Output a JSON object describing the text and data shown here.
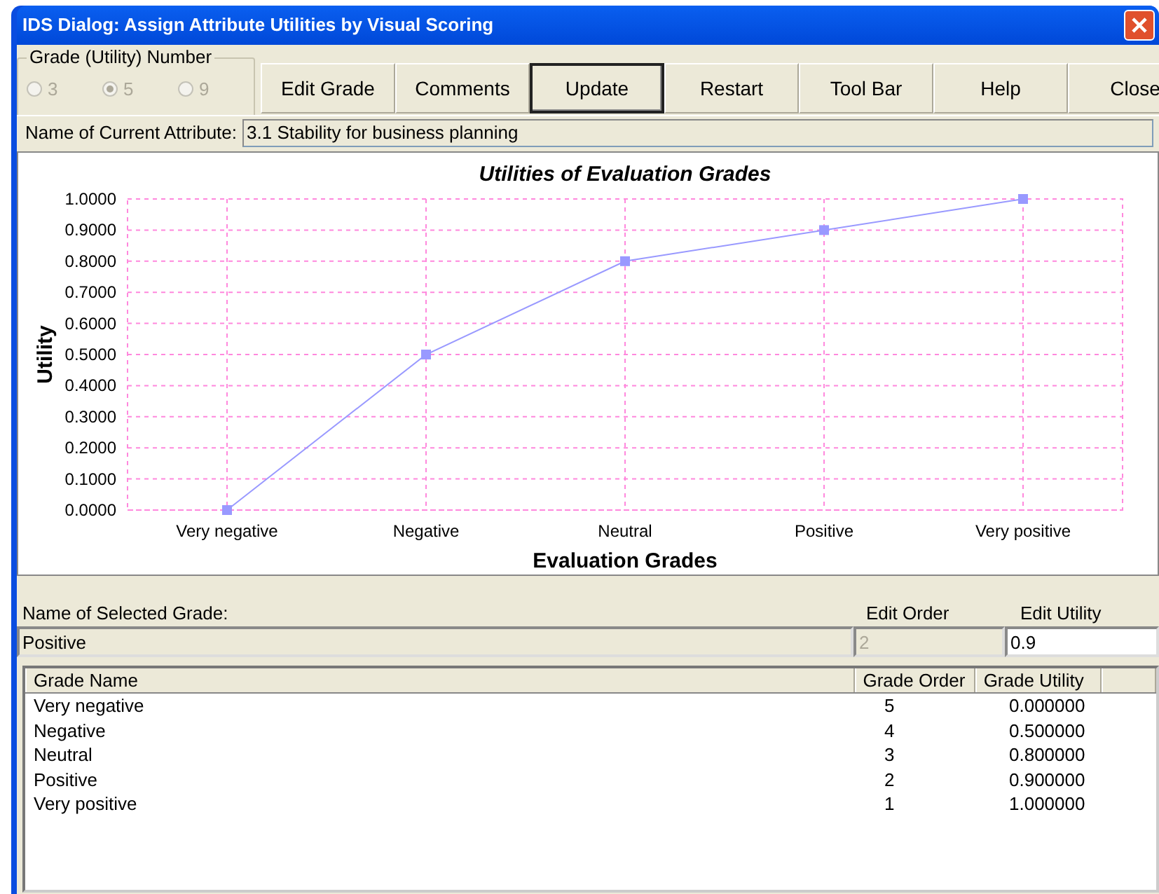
{
  "window": {
    "title": "IDS Dialog: Assign Attribute Utilities by Visual Scoring"
  },
  "grade_number": {
    "label": "Grade (Utility) Number",
    "disabled": true,
    "options": [
      {
        "label": "3",
        "selected": false
      },
      {
        "label": "5",
        "selected": true
      },
      {
        "label": "9",
        "selected": false
      }
    ]
  },
  "buttons": [
    {
      "label": "Edit Grade",
      "default": false
    },
    {
      "label": "Comments",
      "default": false
    },
    {
      "label": "Update",
      "default": true
    },
    {
      "label": "Restart",
      "default": false
    },
    {
      "label": "Tool Bar",
      "default": false
    },
    {
      "label": "Help",
      "default": false
    },
    {
      "label": "Close",
      "default": false
    }
  ],
  "current_attribute": {
    "label": "Name of Current Attribute:",
    "value": "3.1 Stability for business planning"
  },
  "chart_data": {
    "type": "line",
    "title": "Utilities of Evaluation Grades",
    "xlabel": "Evaluation Grades",
    "ylabel": "Utility",
    "categories": [
      "Very negative",
      "Negative",
      "Neutral",
      "Positive",
      "Very positive"
    ],
    "grid": true,
    "series": [
      {
        "color": "#9999ff",
        "marker": "square",
        "values": [
          0,
          0.5,
          0.8,
          0.9,
          1.0
        ]
      }
    ],
    "ylim": [
      0,
      1
    ],
    "yticks": [
      {
        "value": 0,
        "label": "0.0000"
      },
      {
        "value": 0.1,
        "label": "0.1000"
      },
      {
        "value": 0.2,
        "label": "0.2000"
      },
      {
        "value": 0.3,
        "label": "0.3000"
      },
      {
        "value": 0.4,
        "label": "0.4000"
      },
      {
        "value": 0.5,
        "label": "0.5000"
      },
      {
        "value": 0.6,
        "label": "0.6000"
      },
      {
        "value": 0.7,
        "label": "0.7000"
      },
      {
        "value": 0.8,
        "label": "0.8000"
      },
      {
        "value": 0.9,
        "label": "0.9000"
      },
      {
        "value": 1,
        "label": "1.0000"
      }
    ]
  },
  "selected_grade": {
    "name_label": "Name of Selected Grade:",
    "name_value": "Positive",
    "order_label": "Edit Order",
    "order_value": "2",
    "order_disabled": true,
    "utility_label": "Edit Utility",
    "utility_value": "0.9"
  },
  "table": {
    "columns": [
      "Grade Name",
      "Grade Order",
      "Grade Utility"
    ],
    "rows": [
      [
        "Very negative",
        "5",
        "0.000000"
      ],
      [
        "Negative",
        "4",
        "0.500000"
      ],
      [
        "Neutral",
        "3",
        "0.800000"
      ],
      [
        "Positive",
        "2",
        "0.900000"
      ],
      [
        "Very positive",
        "1",
        "1.000000"
      ]
    ]
  }
}
